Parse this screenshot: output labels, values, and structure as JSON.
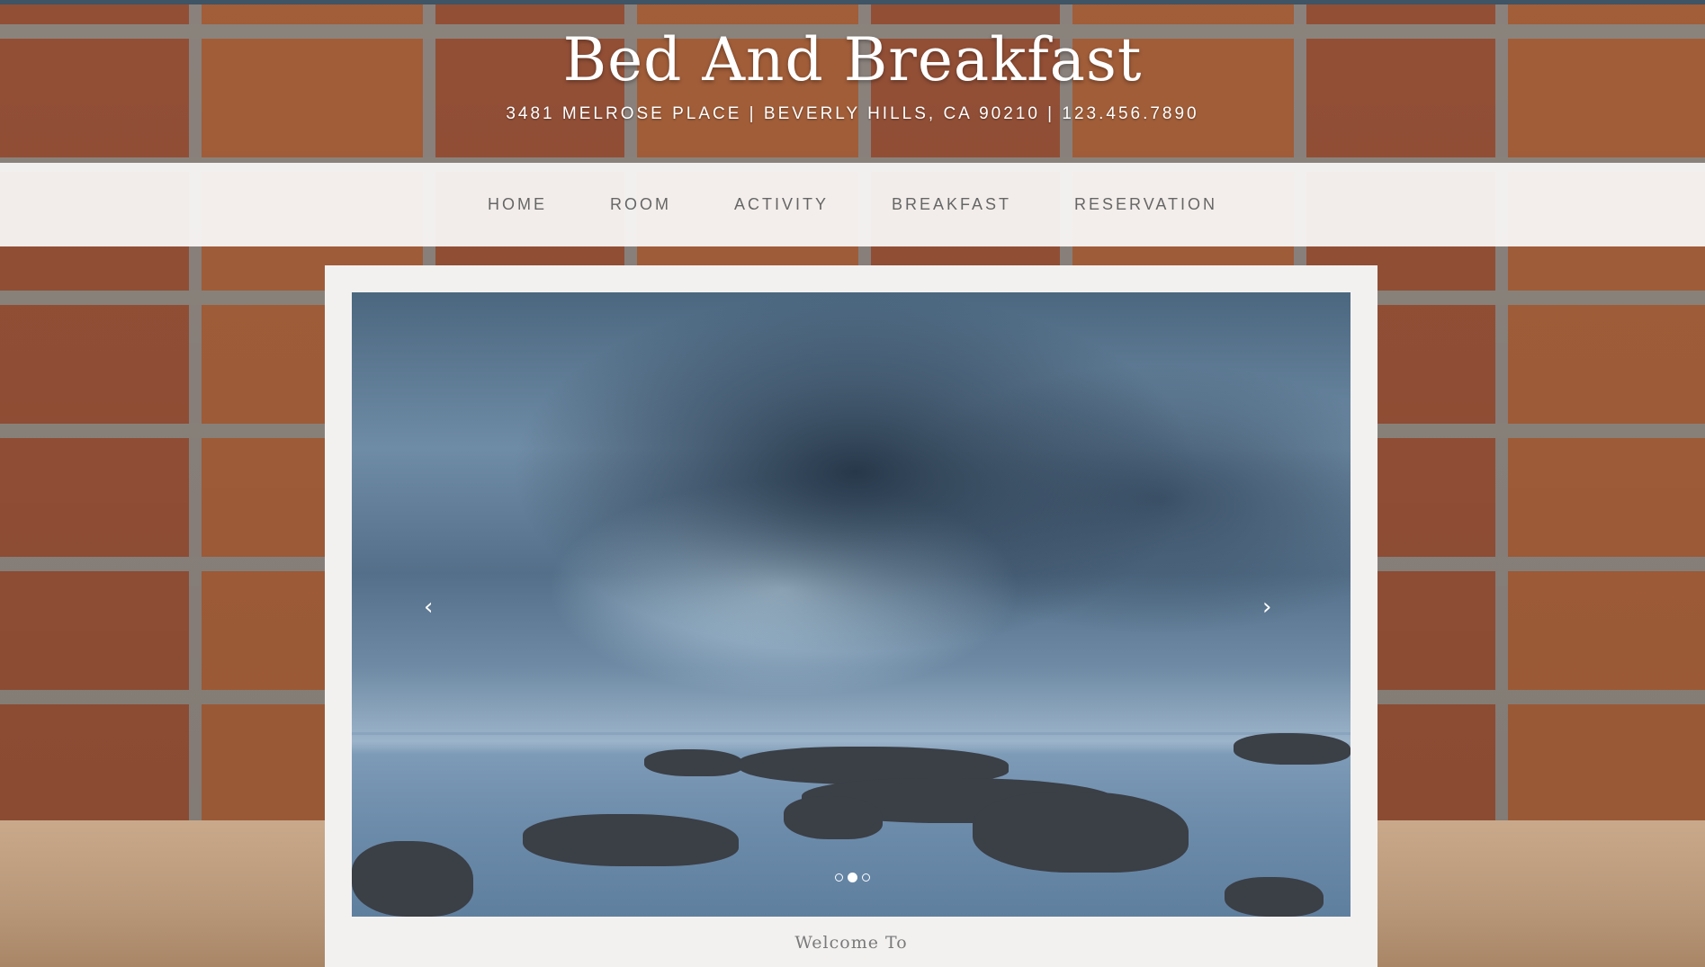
{
  "header": {
    "title": "Bed And Breakfast",
    "address": "3481 MELROSE PLACE | BEVERLY HILLS, CA 90210 | 123.456.7890"
  },
  "nav": {
    "items": [
      {
        "label": "HOME"
      },
      {
        "label": "ROOM"
      },
      {
        "label": "ACTIVITY"
      },
      {
        "label": "BREAKFAST"
      },
      {
        "label": "RESERVATION"
      }
    ]
  },
  "slider": {
    "prev_icon": "chevron-left-icon",
    "next_icon": "chevron-right-icon",
    "prev_glyph": "‹",
    "next_glyph": "›",
    "slide_count": 3,
    "active_slide": 2
  },
  "content": {
    "welcome": "Welcome To"
  },
  "colors": {
    "topline": "#3f5464",
    "nav_text": "#666666",
    "panel_bg": "#f3f1f0"
  }
}
